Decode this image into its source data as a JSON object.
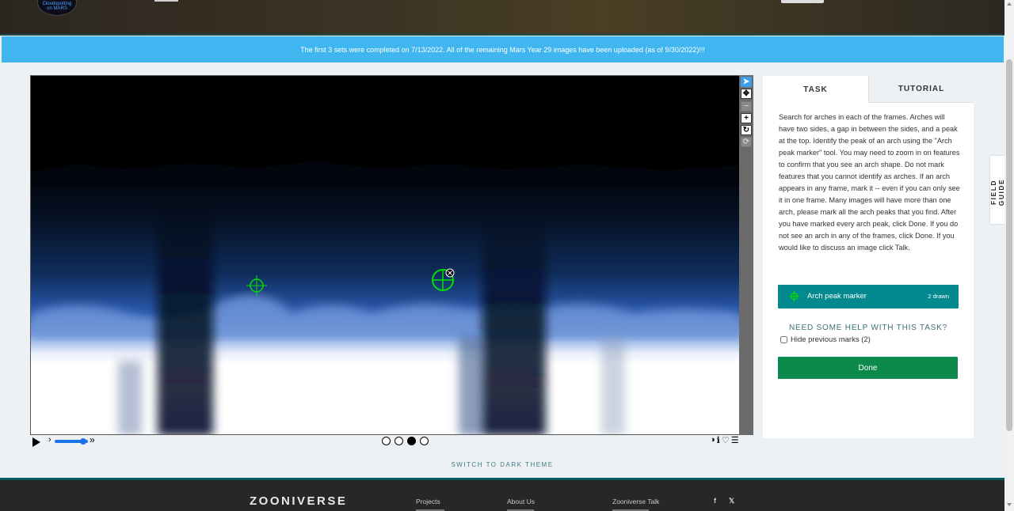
{
  "header": {
    "logo_line1": "Cloudspotting",
    "logo_line2": "on MARS"
  },
  "announcement": "The first 3 sets were completed on 7/13/2022. All of the remaining Mars Year 29 images have been uploaded (as of 9/30/2022)!!!",
  "viewer": {
    "tools": [
      {
        "name": "pointer",
        "icon": "pointer-icon"
      },
      {
        "name": "move",
        "icon": "move-icon"
      },
      {
        "name": "zoom-out",
        "icon": "minus-icon"
      },
      {
        "name": "zoom-in",
        "icon": "plus-icon"
      },
      {
        "name": "rotate",
        "icon": "rotate-icon"
      },
      {
        "name": "reset",
        "icon": "refresh-icon"
      }
    ],
    "markers_drawn": 2,
    "frames_total": 4,
    "current_frame": 3,
    "speed_level": 0.85,
    "speed_slow_glyph": "›",
    "speed_fast_glyph": "»",
    "right_icons": [
      "◑",
      "ℹ",
      "♡",
      "☰"
    ]
  },
  "switch_theme": "SWITCH TO DARK THEME",
  "panel": {
    "tabs": [
      "TASK",
      "TUTORIAL"
    ],
    "instructions": "Search for arches in each of the frames. Arches will have two sides, a gap in between the sides, and a peak at the top. Identify the peak of an arch using the \"Arch peak marker\" tool. You may need to zoom in on features to confirm that you see an arch shape. Do not mark features that you cannot identify as arches. If an arch appears in any frame, mark it -- even if you can only see it in one frame. Many images will have more than one arch, please mark all the arch peaks that you find. After you have marked every arch peak, click Done. If you do not see an arch in any of the frames, click Done. If you would like to discuss an image click Talk.",
    "tool_label": "Arch peak marker",
    "tool_count": "2 drawn",
    "help": "NEED SOME HELP WITH THIS TASK?",
    "hide_marks": "Hide previous marks (2)",
    "done": "Done"
  },
  "field_guide": "FIELD GUIDE",
  "footer": {
    "brand": "ZOONIVERSE",
    "links": [
      "Projects",
      "About Us",
      "Zooniverse Talk"
    ],
    "social": [
      "f",
      "𝕏"
    ]
  },
  "colors": {
    "announce": "#40b6f0",
    "tool_teal": "#04898e",
    "done_green": "#0b8a4c",
    "marker_green": "#00e000"
  }
}
